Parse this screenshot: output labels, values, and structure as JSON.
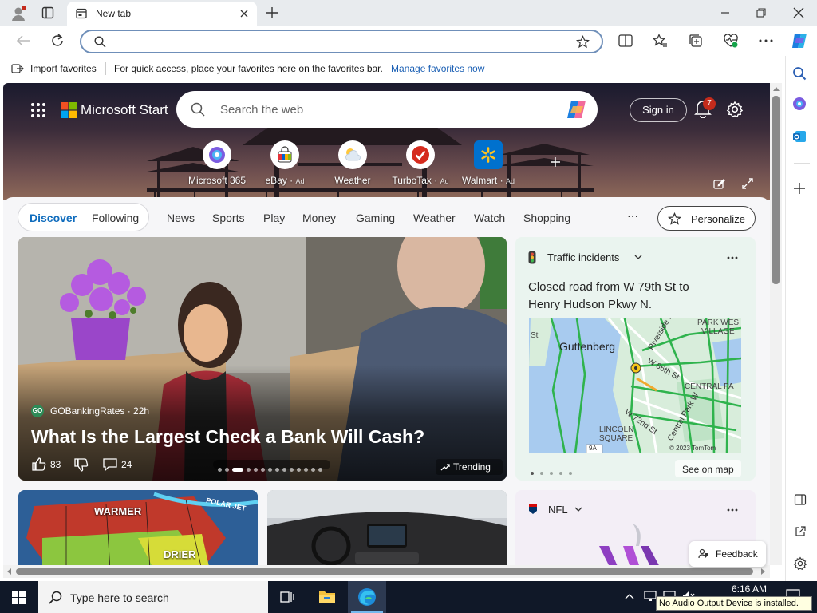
{
  "browser": {
    "tab_title": "New tab",
    "address_value": "",
    "favorites_bar": {
      "import_label": "Import favorites",
      "prompt": "For quick access, place your favorites here on the favorites bar.",
      "manage_link": "Manage favorites now"
    },
    "icons": [
      "profile-icon",
      "tab-actions-icon",
      "new-tab-icon",
      "minimize-icon",
      "restore-icon",
      "close-icon",
      "back-icon",
      "refresh-icon",
      "search-icon",
      "favorite-star-icon",
      "split-screen-icon",
      "favorites-icon",
      "collections-icon",
      "browser-essentials-icon",
      "more-icon",
      "copilot-icon"
    ]
  },
  "start_page": {
    "brand": "Microsoft Start",
    "search_placeholder": "Search the web",
    "sign_in": "Sign in",
    "notification_count": "7",
    "quick_links": [
      {
        "label": "Microsoft 365",
        "ad": ""
      },
      {
        "label": "eBay",
        "ad": "Ad"
      },
      {
        "label": "Weather",
        "ad": ""
      },
      {
        "label": "TurboTax",
        "ad": "Ad"
      },
      {
        "label": "Walmart",
        "ad": "Ad"
      }
    ],
    "tabs": {
      "discover": "Discover",
      "following": "Following"
    },
    "nav": [
      "News",
      "Sports",
      "Play",
      "Money",
      "Gaming",
      "Weather",
      "Watch",
      "Shopping"
    ],
    "more": "···",
    "personalize": "Personalize",
    "main_story": {
      "source_logo": "GO",
      "source": "GOBankingRates · 22h",
      "title": "What Is the Largest Check a Bank Will Cash?",
      "likes": "83",
      "comments": "24",
      "trending": "Trending",
      "carousel_active_index": 2,
      "carousel_count": 14
    },
    "traffic_card": {
      "title": "Traffic incidents",
      "description": "Closed road from W 79th St to Henry Hudson Pkwy N.",
      "map_labels": [
        "PARK WES",
        "VILLAGE",
        "Guttenberg",
        "St",
        "Riverside Dr",
        "W 86th St",
        "CENTRAL PA",
        "W 72nd St",
        "Central Park W",
        "LINCOLN",
        "SQUARE",
        "9A",
        "© 2023 TomTom"
      ],
      "see_on_map": "See on map",
      "pager_count": 5
    },
    "bottom_cards": {
      "weather_labels": [
        "WARMER",
        "DRIER",
        "POLAR JET"
      ],
      "nfl_label": "NFL"
    },
    "feedback": "Feedback"
  },
  "taskbar": {
    "search_placeholder": "Type here to search",
    "time": "6:16 AM",
    "tooltip": "No Audio Output Device is installed."
  },
  "colors": {
    "accent": "#0f6cbd",
    "taskbar": "#101828",
    "hero_top": "#1a1a2e",
    "hero_bottom": "#8e6959",
    "traffic_card_bg": "#eaf4ef"
  }
}
